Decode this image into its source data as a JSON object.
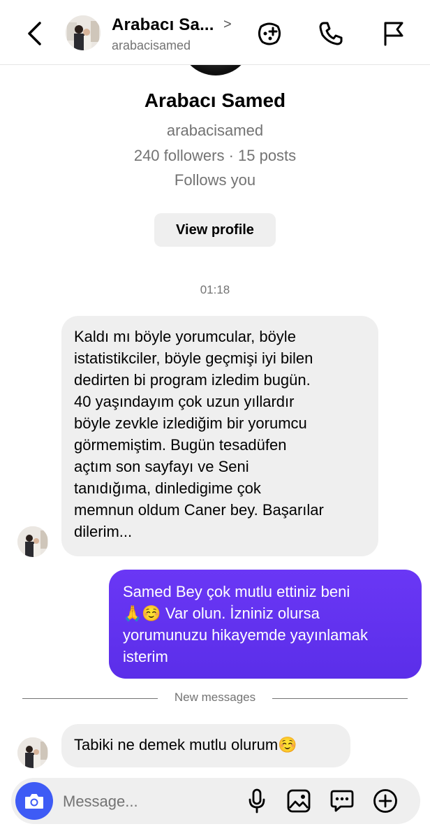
{
  "header": {
    "name": "Arabacı Sa...",
    "chevron": ">",
    "username": "arabacisamed",
    "icons": [
      "back-arrow-icon",
      "avatar",
      "chat-effects-icon",
      "phone-icon",
      "flag-icon"
    ]
  },
  "profile": {
    "name": "Arabacı Samed",
    "username": "arabacisamed",
    "stats": "240 followers · 15 posts",
    "follows": "Follows you",
    "view_button": "View profile"
  },
  "thread": {
    "timestamp": "01:18",
    "incoming_1": "Kaldı mı böyle yorumcular, böyle\nistatistikciler, böyle geçmişi iyi bilen\ndedirten bi program izledim bugün.\n40 yaşındayım çok uzun yıllardır\nböyle zevkle izlediğim bir yorumcu\ngörmemiştim. Bugün tesadüfen\naçtım son sayfayı ve Seni\ntanıdığıma, dinledigime çok\nmemnun oldum Caner bey. Başarılar\ndilerim...",
    "outgoing_1": "Samed Bey çok mutlu ettiniz beni\n🙏☺️ Var olun. İzniniz olursa\nyorumunuzu hikayemde yayınlamak\nisterim",
    "new_messages": "New messages",
    "incoming_2": "Tabiki ne demek mutlu olurum☺️"
  },
  "composer": {
    "placeholder": "Message...",
    "icons": [
      "camera-icon",
      "microphone-icon",
      "gallery-icon",
      "sticker-icon",
      "add-icon"
    ]
  },
  "colors": {
    "outgoing_bubble": "#6432f2",
    "incoming_bubble": "#efefef",
    "camera_button": "#3e5bf5",
    "secondary_text": "#737373"
  }
}
